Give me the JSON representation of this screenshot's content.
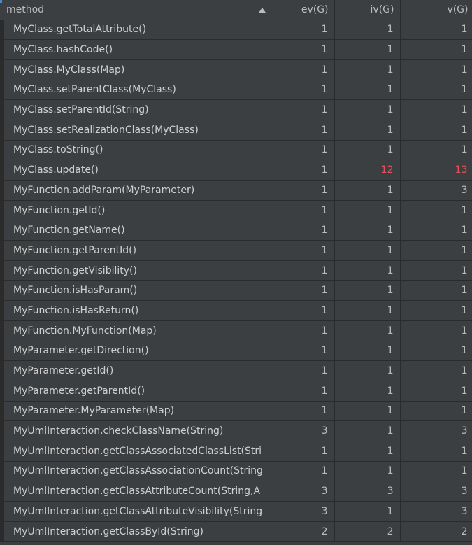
{
  "columns": {
    "method": "method",
    "ev": "ev(G)",
    "iv": "iv(G)",
    "v": "v(G)"
  },
  "sort": {
    "column": "method",
    "direction": "ascending",
    "icon": "sort-ascending-icon"
  },
  "colors": {
    "background": "#3c3f41",
    "grid": "#2b2b2b",
    "text": "#bbbbbb",
    "highlight": "#e5525a",
    "scroll_indicator": "#4a88c7"
  },
  "rows": [
    {
      "method": "MyClass.getTotalAttribute()",
      "ev": "1",
      "iv": "1",
      "v": "1"
    },
    {
      "method": "MyClass.hashCode()",
      "ev": "1",
      "iv": "1",
      "v": "1"
    },
    {
      "method": "MyClass.MyClass(Map)",
      "ev": "1",
      "iv": "1",
      "v": "1"
    },
    {
      "method": "MyClass.setParentClass(MyClass)",
      "ev": "1",
      "iv": "1",
      "v": "1"
    },
    {
      "method": "MyClass.setParentId(String)",
      "ev": "1",
      "iv": "1",
      "v": "1"
    },
    {
      "method": "MyClass.setRealizationClass(MyClass)",
      "ev": "1",
      "iv": "1",
      "v": "1"
    },
    {
      "method": "MyClass.toString()",
      "ev": "1",
      "iv": "1",
      "v": "1"
    },
    {
      "method": "MyClass.update()",
      "ev": "1",
      "iv": "12",
      "v": "13",
      "iv_hot": true,
      "v_hot": true
    },
    {
      "method": "MyFunction.addParam(MyParameter)",
      "ev": "1",
      "iv": "1",
      "v": "3"
    },
    {
      "method": "MyFunction.getId()",
      "ev": "1",
      "iv": "1",
      "v": "1"
    },
    {
      "method": "MyFunction.getName()",
      "ev": "1",
      "iv": "1",
      "v": "1"
    },
    {
      "method": "MyFunction.getParentId()",
      "ev": "1",
      "iv": "1",
      "v": "1"
    },
    {
      "method": "MyFunction.getVisibility()",
      "ev": "1",
      "iv": "1",
      "v": "1"
    },
    {
      "method": "MyFunction.isHasParam()",
      "ev": "1",
      "iv": "1",
      "v": "1"
    },
    {
      "method": "MyFunction.isHasReturn()",
      "ev": "1",
      "iv": "1",
      "v": "1"
    },
    {
      "method": "MyFunction.MyFunction(Map)",
      "ev": "1",
      "iv": "1",
      "v": "1"
    },
    {
      "method": "MyParameter.getDirection()",
      "ev": "1",
      "iv": "1",
      "v": "1"
    },
    {
      "method": "MyParameter.getId()",
      "ev": "1",
      "iv": "1",
      "v": "1"
    },
    {
      "method": "MyParameter.getParentId()",
      "ev": "1",
      "iv": "1",
      "v": "1"
    },
    {
      "method": "MyParameter.MyParameter(Map)",
      "ev": "1",
      "iv": "1",
      "v": "1"
    },
    {
      "method": "MyUmlInteraction.checkClassName(String)",
      "ev": "3",
      "iv": "1",
      "v": "3"
    },
    {
      "method": "MyUmlInteraction.getClassAssociatedClassList(Stri",
      "ev": "1",
      "iv": "1",
      "v": "1"
    },
    {
      "method": "MyUmlInteraction.getClassAssociationCount(String",
      "ev": "1",
      "iv": "1",
      "v": "1"
    },
    {
      "method": "MyUmlInteraction.getClassAttributeCount(String,A",
      "ev": "3",
      "iv": "3",
      "v": "3"
    },
    {
      "method": "MyUmlInteraction.getClassAttributeVisibility(String",
      "ev": "3",
      "iv": "1",
      "v": "3"
    },
    {
      "method": "MyUmlInteraction.getClassById(String)",
      "ev": "2",
      "iv": "2",
      "v": "2"
    }
  ]
}
